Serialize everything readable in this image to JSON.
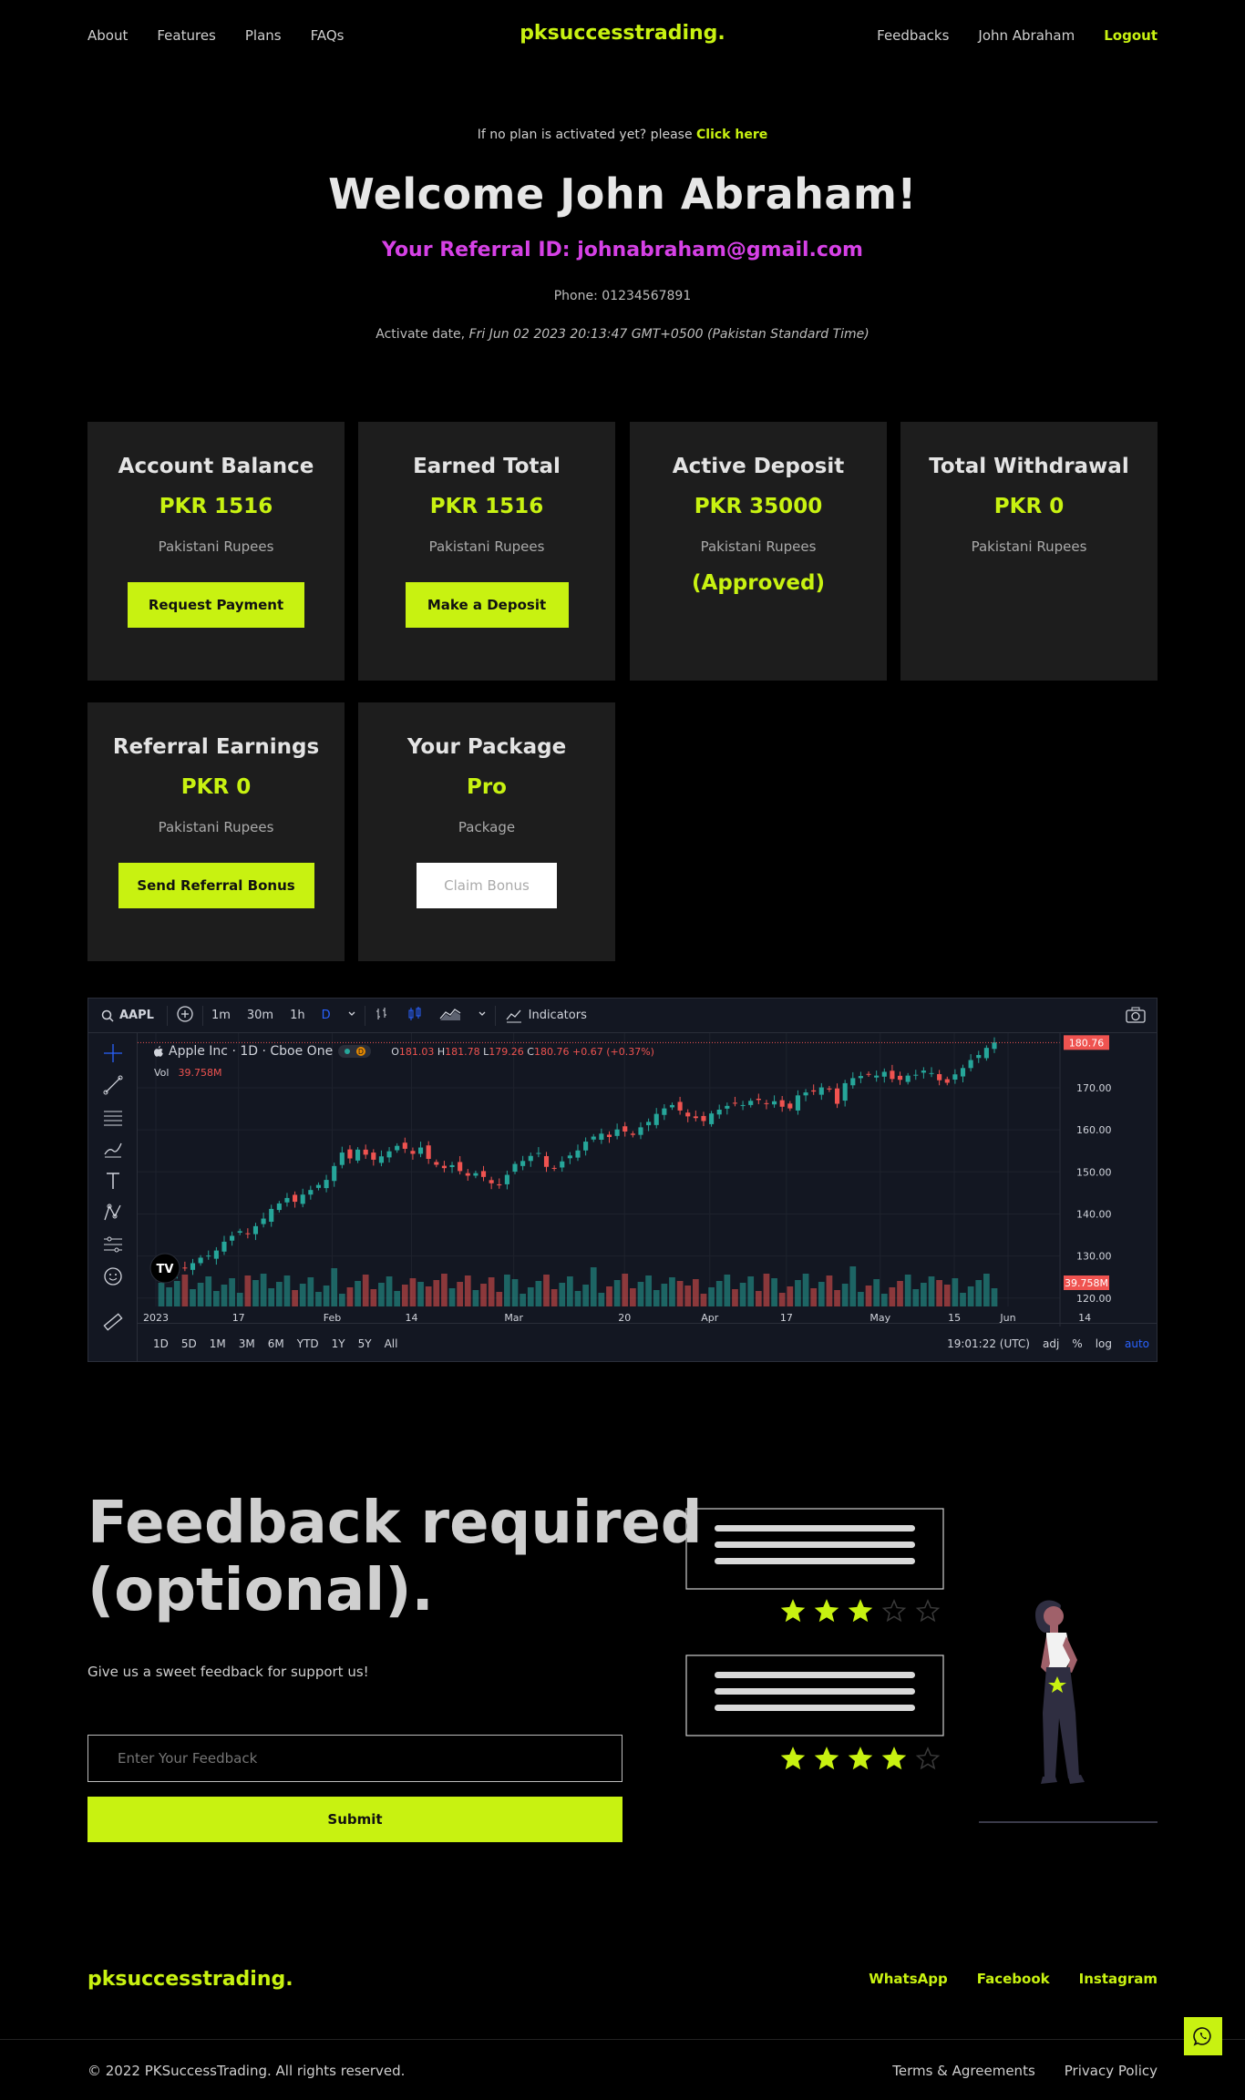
{
  "nav": {
    "left": [
      "About",
      "Features",
      "Plans",
      "FAQs"
    ],
    "brand": "pksuccesstrading.",
    "feedbacks": "Feedbacks",
    "user": "John Abraham",
    "logout": "Logout"
  },
  "hero": {
    "notice": "If no plan is activated yet? please",
    "notice_link": "Click here",
    "welcome": "Welcome John Abraham!",
    "referral": "Your Referral ID: johnabraham@gmail.com",
    "phone": "Phone: 01234567891",
    "activate_label": "Activate date,",
    "activate_value": "Fri Jun 02 2023 20:13:47 GMT+0500 (Pakistan Standard Time)"
  },
  "cards": [
    {
      "title": "Account Balance",
      "amount": "PKR 1516",
      "sub": "Pakistani Rupees",
      "button": "Request Payment"
    },
    {
      "title": "Earned Total",
      "amount": "PKR 1516",
      "sub": "Pakistani Rupees",
      "button": "Make a Deposit"
    },
    {
      "title": "Active Deposit",
      "amount": "PKR 35000",
      "sub": "Pakistani Rupees",
      "status": "(Approved)"
    },
    {
      "title": "Total Withdrawal",
      "amount": "PKR 0",
      "sub": "Pakistani Rupees"
    },
    {
      "title": "Referral Earnings",
      "amount": "PKR 0",
      "sub": "Pakistani Rupees",
      "button": "Send Referral Bonus"
    },
    {
      "title": "Your Package",
      "amount": "Pro",
      "sub": "Package",
      "button": "Claim Bonus"
    }
  ],
  "tv": {
    "symbol": "AAPL",
    "intervals": [
      "1m",
      "30m",
      "1h",
      "D"
    ],
    "active_interval": "D",
    "indicators": "Indicators",
    "legend_title": "Apple Inc · 1D · Cboe One",
    "ohlc": {
      "o": "181.03",
      "h": "181.78",
      "l": "179.26",
      "c": "180.76",
      "chg": "+0.67 (+0.37%)"
    },
    "vol_label": "Vol",
    "vol_value": "39.758M",
    "ranges": [
      "1D",
      "5D",
      "1M",
      "3M",
      "6M",
      "YTD",
      "1Y",
      "5Y",
      "All"
    ],
    "time": "19:01:22 (UTC)",
    "options": [
      "adj",
      "%",
      "log",
      "auto"
    ],
    "up_color": "#26a69a",
    "down_color": "#ef5350"
  },
  "chart_data": {
    "type": "candlestick",
    "title": "Apple Inc · 1D · Cboe One",
    "x_ticks": [
      "2023",
      "17",
      "Feb",
      "14",
      "Mar",
      "20",
      "Apr",
      "17",
      "May",
      "15",
      "Jun",
      "14"
    ],
    "y_ticks": [
      120,
      130,
      140,
      150,
      160,
      170
    ],
    "ylim": [
      118,
      183
    ],
    "last_price": 180.76,
    "last_volume": "39.758M",
    "close_series": [
      125.1,
      125.8,
      126.5,
      127.2,
      128.3,
      129.6,
      130.1,
      131.3,
      133.4,
      134.8,
      135.9,
      135.2,
      137.1,
      138.9,
      141.2,
      142.5,
      143.8,
      142.9,
      144.6,
      145.7,
      146.9,
      148.1,
      151.4,
      154.6,
      153.2,
      155.3,
      154.1,
      152.9,
      153.7,
      154.9,
      156.2,
      155.5,
      154.3,
      155.8,
      153.1,
      151.7,
      150.9,
      151.6,
      150.2,
      149.1,
      149.7,
      148.8,
      147.3,
      146.8,
      149.3,
      151.9,
      152.6,
      153.8,
      154.5,
      151.2,
      150.8,
      152.5,
      153.9,
      155.1,
      157.2,
      158.4,
      159.1,
      158.3,
      160.1,
      159.6,
      158.8,
      160.6,
      161.9,
      163.8,
      165.1,
      165.9,
      164.6,
      163.2,
      162.8,
      162.1,
      163.9,
      164.8,
      165.7,
      166.4,
      165.9,
      166.9,
      167.1,
      166.3,
      166.8,
      165.5,
      165.1,
      168.2,
      168.9,
      169.1,
      170.1,
      169.6,
      166.2,
      171.1,
      172.3,
      172.8,
      173.2,
      172.9,
      173.8,
      172.1,
      171.9,
      172.9,
      173.1,
      174.1,
      173.5,
      171.8,
      171.2,
      173.2,
      174.7,
      176.6,
      177.8,
      179.5,
      180.8
    ],
    "up_color": "#26a69a",
    "down_color": "#ef5350"
  },
  "feedback": {
    "title_line1": "Feedback required",
    "title_line2": "(optional).",
    "subtitle": "Give us a sweet feedback for support us!",
    "placeholder": "Enter Your Feedback",
    "submit": "Submit",
    "review1_stars": 3,
    "review2_stars": 4,
    "max_stars": 5
  },
  "footer": {
    "brand": "pksuccesstrading.",
    "links": [
      "WhatsApp",
      "Facebook",
      "Instagram"
    ],
    "copyright": "© 2022 PKSuccessTrading. All rights reserved.",
    "legal": [
      "Terms & Agreements",
      "Privacy Policy"
    ]
  }
}
